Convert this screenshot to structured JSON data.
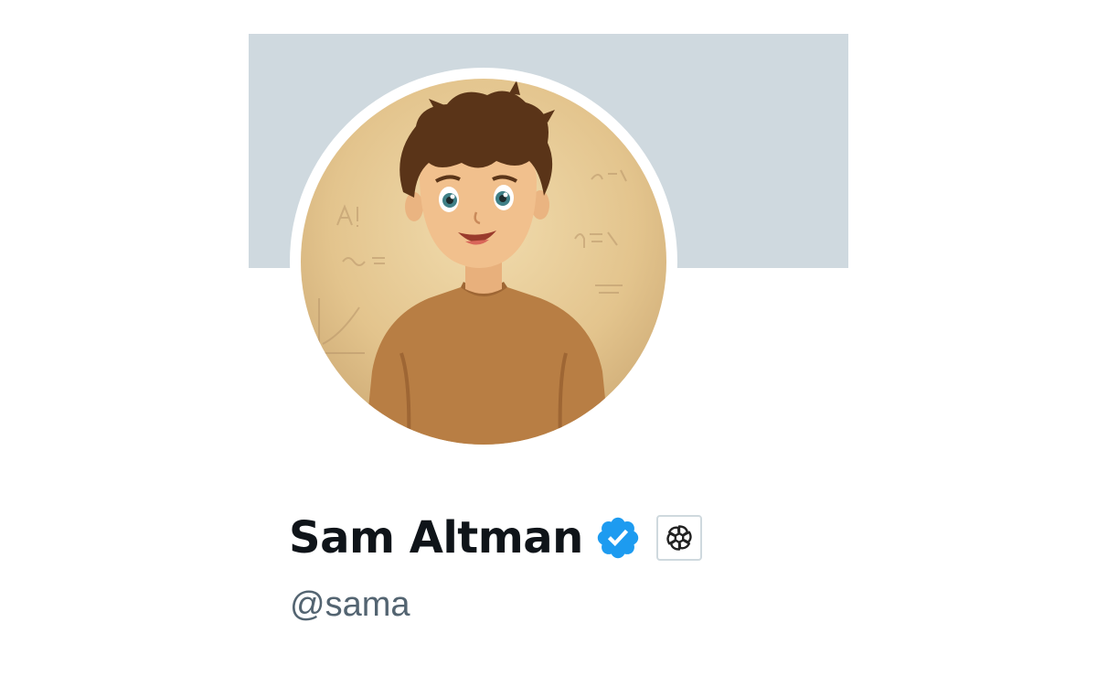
{
  "profile": {
    "display_name": "Sam Altman",
    "handle": "@sama",
    "verified": true,
    "affiliate_badge_icon": "openai-logo-icon",
    "verified_icon": "verified-checkmark-icon"
  },
  "colors": {
    "banner": "#cfd9df",
    "verified_blue": "#1d9bf0",
    "name_text": "#0f1419",
    "handle_text": "#536471"
  }
}
